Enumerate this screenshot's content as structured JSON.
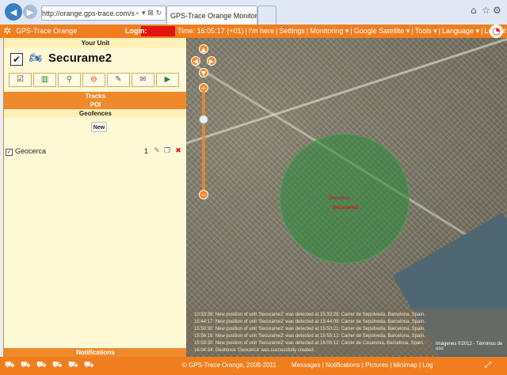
{
  "browser": {
    "url": "http://orange.gps-trace.com/s",
    "url_icons": "⌕ ▾ ⊠ ↻ ✕",
    "tab_title": "GPS-Trace Orange Monitori...",
    "tab2": "",
    "win_icons": [
      "⌂",
      "☆",
      "⚙"
    ]
  },
  "topbar": {
    "app_name": "GPS-Trace Orange",
    "login_label": "Login:",
    "menu": [
      "Time: 16:05:17 (+01)",
      "I'm here",
      "Settings",
      "Monitoring ▾",
      "Google Satellite ▾",
      "Tools ▾",
      "Language ▾",
      "Logout"
    ]
  },
  "panel": {
    "your_unit": "Your Unit",
    "unit_name": "Securame2",
    "tracks": "Tracks",
    "poi": "POI",
    "geofences": "Geofences",
    "new_button": "New",
    "geofence": {
      "name": "Geocerca",
      "count": "1"
    },
    "notifications": "Notifications"
  },
  "map": {
    "fence_label": "Geocerca",
    "unit_label": "Securame2",
    "events": [
      "10:33:38: New position of unit 'Securame2' was detected at 15:33:28: Carrer de Sepúlveda, Barcelona, Spain.",
      "15:44:17: New position of unit 'Securame2' was detected at 15:44:09: Carrer de Sepúlveda, Barcelona, Spain.",
      "15:50:30: New position of unit 'Securame2' was detected at 15:50:21: Carrer de Sepúlveda, Barcelona, Spain.",
      "15:56:18: New position of unit 'Securame2' was detected at 15:55:12: Carrer de Sepúlveda, Barcelona, Spain.",
      "15:59:30: New position of unit 'Securame2' was detected at 16:00:12: Carrer de Casanova, Barcelona, Spain.",
      "16:04:34: Geofence 'Geocerca' was successfully created."
    ],
    "copyright": "Imágenes ©2012 - Términos de uso"
  },
  "bottombar": {
    "footer": "© GPS-Trace Orange, 2008-2011",
    "menu": "Messages | Notifications | Pictures | Minimap | Log"
  }
}
